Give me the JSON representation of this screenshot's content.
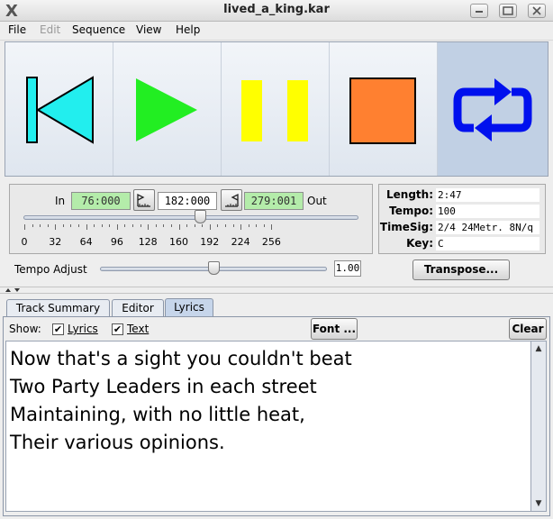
{
  "window": {
    "title": "lived_a_king.kar",
    "app_icon": "x-icon"
  },
  "menubar": {
    "items": [
      {
        "label": "File",
        "enabled": true
      },
      {
        "label": "Edit",
        "enabled": false
      },
      {
        "label": "Sequence",
        "enabled": true
      },
      {
        "label": "View",
        "enabled": true
      },
      {
        "label": "Help",
        "enabled": true
      }
    ]
  },
  "transport": {
    "buttons": [
      "rewind-icon",
      "play-icon",
      "pause-icon",
      "stop-icon",
      "loop-icon"
    ],
    "colors": {
      "rewind": "#22eeee",
      "play": "#22ee22",
      "pause": "#ffff00",
      "stop": "#ff8030",
      "loop": "#0010ee",
      "active_bg": "#c1d0e4"
    },
    "loop_active": true
  },
  "position": {
    "in_label": "In",
    "in_value": "76:000",
    "current_value": "182:000",
    "out_value": "279:001",
    "out_label": "Out",
    "slider_value": 182,
    "slider_max": 279,
    "ticks": [
      "0",
      "32",
      "64",
      "96",
      "128",
      "160",
      "192",
      "224",
      "256"
    ]
  },
  "info": {
    "length_label": "Length:",
    "length_value": "2:47",
    "tempo_label": "Tempo:",
    "tempo_value": "100",
    "timesig_label": "TimeSig:",
    "timesig_value": "2/4 24Metr. 8N/q",
    "key_label": "Key:",
    "key_value": "C"
  },
  "tempo_adjust": {
    "label": "Tempo Adjust",
    "value": "1.00",
    "slider_fraction": 0.5
  },
  "transpose_button": "Transpose...",
  "tabs": [
    {
      "label": "Track Summary",
      "selected": false
    },
    {
      "label": "Editor",
      "selected": false
    },
    {
      "label": "Lyrics",
      "selected": true
    }
  ],
  "lyrics_panel": {
    "show_label": "Show:",
    "lyrics_check_label": "Lyrics",
    "lyrics_checked": true,
    "text_check_label": "Text",
    "text_checked": true,
    "font_button": "Font ...",
    "clear_button": "Clear",
    "lines": [
      "Now that's a sight you couldn't beat",
      "Two Party Leaders in each street",
      "Maintaining, with no little heat,",
      "Their various opinions."
    ]
  }
}
